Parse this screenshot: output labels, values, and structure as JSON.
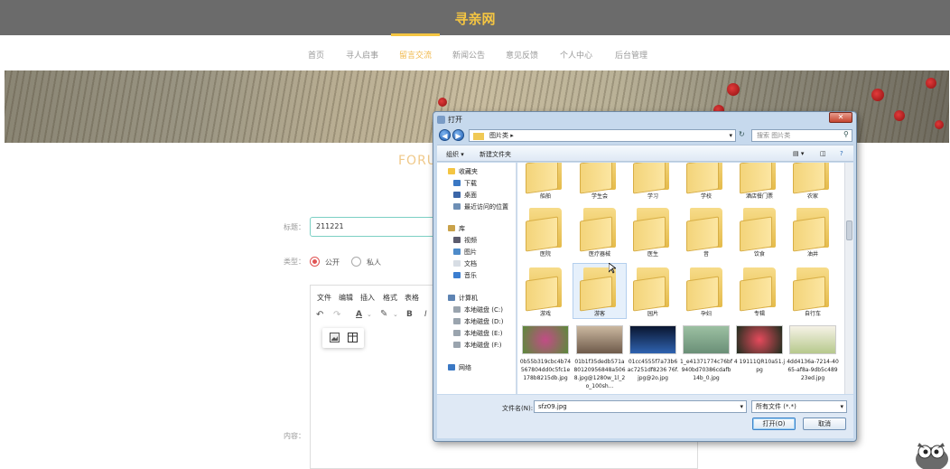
{
  "site": {
    "title": "寻亲网"
  },
  "nav": {
    "items": [
      {
        "label": "首页"
      },
      {
        "label": "寻人启事"
      },
      {
        "label": "留言交流"
      },
      {
        "label": "新闻公告"
      },
      {
        "label": "意见反馈"
      },
      {
        "label": "个人中心"
      },
      {
        "label": "后台管理"
      }
    ],
    "active_index": 2
  },
  "forum": {
    "heading": "FORU"
  },
  "form": {
    "title_label": "标题：",
    "title_value": "211221",
    "type_label": "类型：",
    "type_options": [
      {
        "label": "公开",
        "checked": true
      },
      {
        "label": "私人",
        "checked": false
      }
    ],
    "content_label": "内容："
  },
  "editor": {
    "menus": [
      "文件",
      "编辑",
      "插入",
      "格式",
      "表格"
    ],
    "tools": [
      "undo-icon",
      "redo-icon",
      "text-color-icon",
      "highlight-icon",
      "bold-icon",
      "italic-icon"
    ],
    "bold": "B",
    "italic": "I",
    "text_color": "A",
    "popup_tools": [
      "image-icon",
      "table-icon"
    ]
  },
  "dialog": {
    "title": "打开",
    "close": "✕",
    "address": "图片类 ▸",
    "search_placeholder": "搜索 图片类",
    "toolbar": {
      "organize": "组织 ▾",
      "new_folder": "新建文件夹"
    },
    "tree": [
      {
        "label": "收藏夹",
        "icon": "star-icon",
        "level": 0
      },
      {
        "label": "下载",
        "icon": "download-folder-icon",
        "level": 1
      },
      {
        "label": "桌面",
        "icon": "desktop-icon",
        "level": 1
      },
      {
        "label": "最近访问的位置",
        "icon": "recent-icon",
        "level": 1
      },
      {
        "label": "库",
        "icon": "library-icon",
        "level": 0
      },
      {
        "label": "视频",
        "icon": "video-icon",
        "level": 1
      },
      {
        "label": "图片",
        "icon": "picture-icon",
        "level": 1
      },
      {
        "label": "文档",
        "icon": "document-icon",
        "level": 1
      },
      {
        "label": "音乐",
        "icon": "music-icon",
        "level": 1
      },
      {
        "label": "计算机",
        "icon": "computer-icon",
        "level": 0
      },
      {
        "label": "本地磁盘 (C:)",
        "icon": "drive-icon",
        "level": 1
      },
      {
        "label": "本地磁盘 (D:)",
        "icon": "drive-icon",
        "level": 1
      },
      {
        "label": "本地磁盘 (E:)",
        "icon": "drive-icon",
        "level": 1
      },
      {
        "label": "本地磁盘 (F:)",
        "icon": "drive-icon",
        "level": 1
      },
      {
        "label": "网络",
        "icon": "network-icon",
        "level": 0
      }
    ],
    "folders_row1": [
      "船舶",
      "学生会",
      "学习",
      "学校",
      "酒店餐门票",
      "农家"
    ],
    "folders_row2": [
      "医院",
      "医疗器械",
      "医生",
      "音",
      "饮食",
      "油井"
    ],
    "folders_row3": [
      "游戏",
      "游客",
      "园片",
      "孕妇",
      "专辑",
      "自行车"
    ],
    "photos": [
      {
        "name": "0b55b319cbc4b74567804dd0c5fc1e178b8215db.jpg"
      },
      {
        "name": "01b1f35dedb571a80120956848a5068.jpg@1280w_1l_2o_100sh..."
      },
      {
        "name": "01cc4555f7a73b6ac7251df8236 76f.jpg@2o.jpg"
      },
      {
        "name": "1_e41371774c76bf940bd70386cdafb14b_0.jpg"
      },
      {
        "name": "4 19111QR10a51.jpg"
      },
      {
        "name": "4dd4136a-7214-4065-af8a-9db5c48923ed.jpg"
      }
    ],
    "filename_label": "文件名(N):",
    "filename_value": "sfz09.jpg",
    "filetype": "所有文件 (*.*)",
    "open_button": "打开(O)",
    "cancel_button": "取消"
  }
}
